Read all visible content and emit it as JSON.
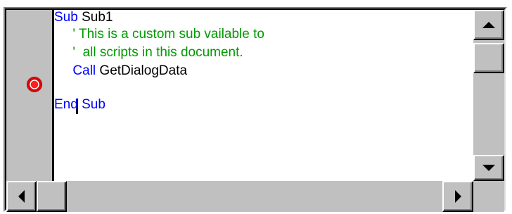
{
  "editor": {
    "lines": [
      {
        "keyword": "Sub",
        "text": " Sub1",
        "indent": ""
      },
      {
        "comment": "' This is a custom sub vailable to",
        "indent": "     "
      },
      {
        "comment": "'  all scripts in this document.",
        "indent": "     "
      },
      {
        "keyword": "Call",
        "text": " GetDialogData",
        "indent": "     "
      },
      {
        "blank": true
      },
      {
        "keyword": "End Sub",
        "text": "",
        "indent": ""
      }
    ],
    "breakpoint_line": 4
  },
  "colors": {
    "keyword": "#0000ff",
    "comment": "#009900",
    "breakpoint": "#ff0000"
  },
  "icons": {
    "scroll_up": "triangle-up-icon",
    "scroll_down": "triangle-down-icon",
    "scroll_left": "triangle-left-icon",
    "scroll_right": "triangle-right-icon",
    "breakpoint": "breakpoint-dot-icon"
  }
}
